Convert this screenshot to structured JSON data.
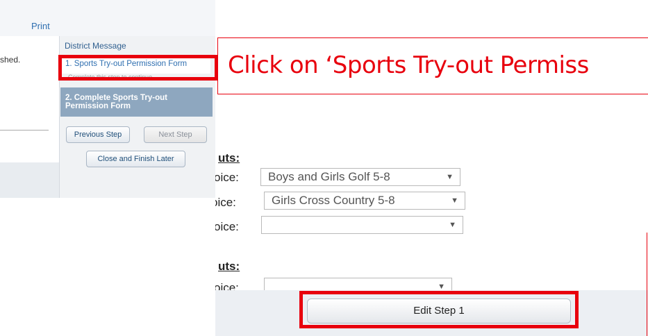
{
  "top_snippet": {
    "print_link": "Print",
    "left_text": "shed.",
    "panel": {
      "title": "District Message",
      "step1": "1. Sports Try-out Permission Form",
      "step1_subtext": "Complete this step to continue",
      "step2": "2. Complete Sports Try-out Permission Form",
      "previous_button": "Previous Step",
      "next_button": "Next Step",
      "close_button": "Close and Finish Later"
    }
  },
  "callout": {
    "text": "Click on ‘Sports Try-out Permiss"
  },
  "form_snippet": {
    "section1_heading": "uts:",
    "rows1": [
      {
        "label": "oice:",
        "value": "Boys and Girls Golf 5-8"
      },
      {
        "label": "oice:",
        "value": "Girls Cross Country 5-8"
      },
      {
        "label": "oice:",
        "value": ""
      }
    ],
    "section2_heading": "uts:",
    "row2_label": "oice:",
    "row2_value": "",
    "dropdown_arrow": "▼",
    "edit_button": "Edit Step 1"
  },
  "colors": {
    "highlight_red": "#e8000d",
    "step_active_bg": "#8ea7bf",
    "link_blue": "#2f6fb0"
  }
}
